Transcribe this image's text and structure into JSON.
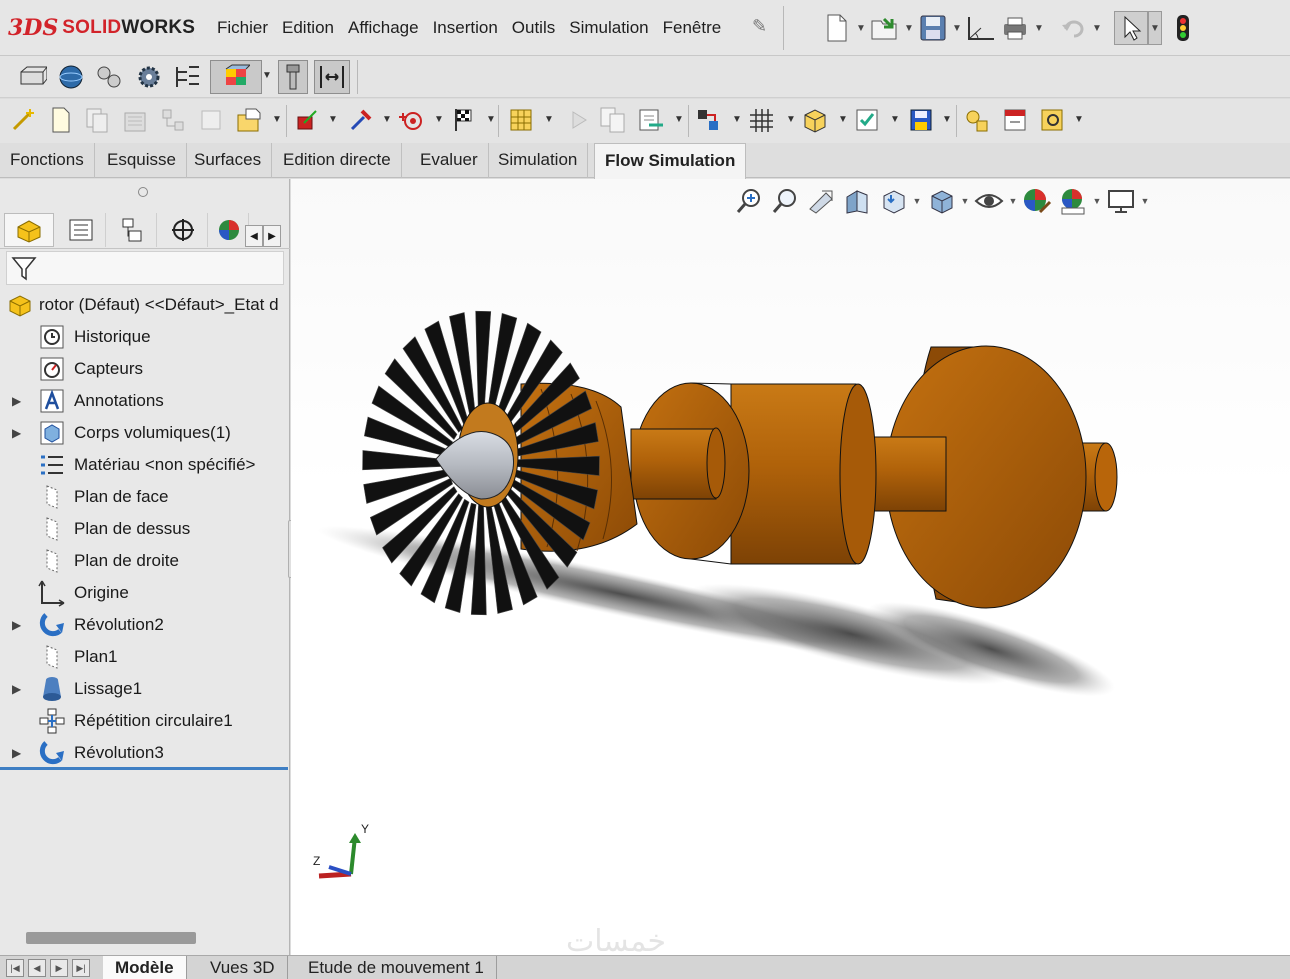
{
  "app": {
    "brand_prefix": "3DS",
    "brand_name_red": "SOLID",
    "brand_name_dark": "WORKS"
  },
  "menu": [
    "Fichier",
    "Edition",
    "Affichage",
    "Insertion",
    "Outils",
    "Simulation",
    "Fenêtre"
  ],
  "command_tabs": [
    "Fonctions",
    "Esquisse",
    "Surfaces",
    "Edition directe",
    "Evaluer",
    "Simulation",
    "Flow Simulation"
  ],
  "active_command_tab": "Flow Simulation",
  "tree": {
    "root": "rotor (Défaut) <<Défaut>_Etat d",
    "items": [
      {
        "label": "Historique",
        "icon": "history-icon",
        "expandable": false
      },
      {
        "label": "Capteurs",
        "icon": "sensor-icon",
        "expandable": false
      },
      {
        "label": "Annotations",
        "icon": "annotations-icon",
        "expandable": true
      },
      {
        "label": "Corps volumiques(1)",
        "icon": "solid-body-icon",
        "expandable": true
      },
      {
        "label": "Matériau <non spécifié>",
        "icon": "material-icon",
        "expandable": false
      },
      {
        "label": "Plan de face",
        "icon": "plane-icon",
        "expandable": false
      },
      {
        "label": "Plan de dessus",
        "icon": "plane-icon",
        "expandable": false
      },
      {
        "label": "Plan de droite",
        "icon": "plane-icon",
        "expandable": false
      },
      {
        "label": "Origine",
        "icon": "origin-icon",
        "expandable": false
      },
      {
        "label": "Révolution2",
        "icon": "revolve-icon",
        "expandable": true
      },
      {
        "label": "Plan1",
        "icon": "plane-icon",
        "expandable": false
      },
      {
        "label": "Lissage1",
        "icon": "loft-icon",
        "expandable": true
      },
      {
        "label": "Répétition circulaire1",
        "icon": "circular-pattern-icon",
        "expandable": false
      },
      {
        "label": "Révolution3",
        "icon": "revolve-icon",
        "expandable": true
      }
    ]
  },
  "triad": {
    "y": "Y",
    "z": "Z"
  },
  "watermark": "خمسات",
  "bottom_tabs": [
    "Modèle",
    "Vues 3D",
    "Etude de mouvement 1"
  ],
  "active_bottom_tab": "Modèle",
  "colors": {
    "accent": "#3f7fc4",
    "brand_red": "#d2232a",
    "rotor_orange": "#b8650a",
    "blade_black": "#111111",
    "spinner_gray": "#b9bcc2"
  }
}
